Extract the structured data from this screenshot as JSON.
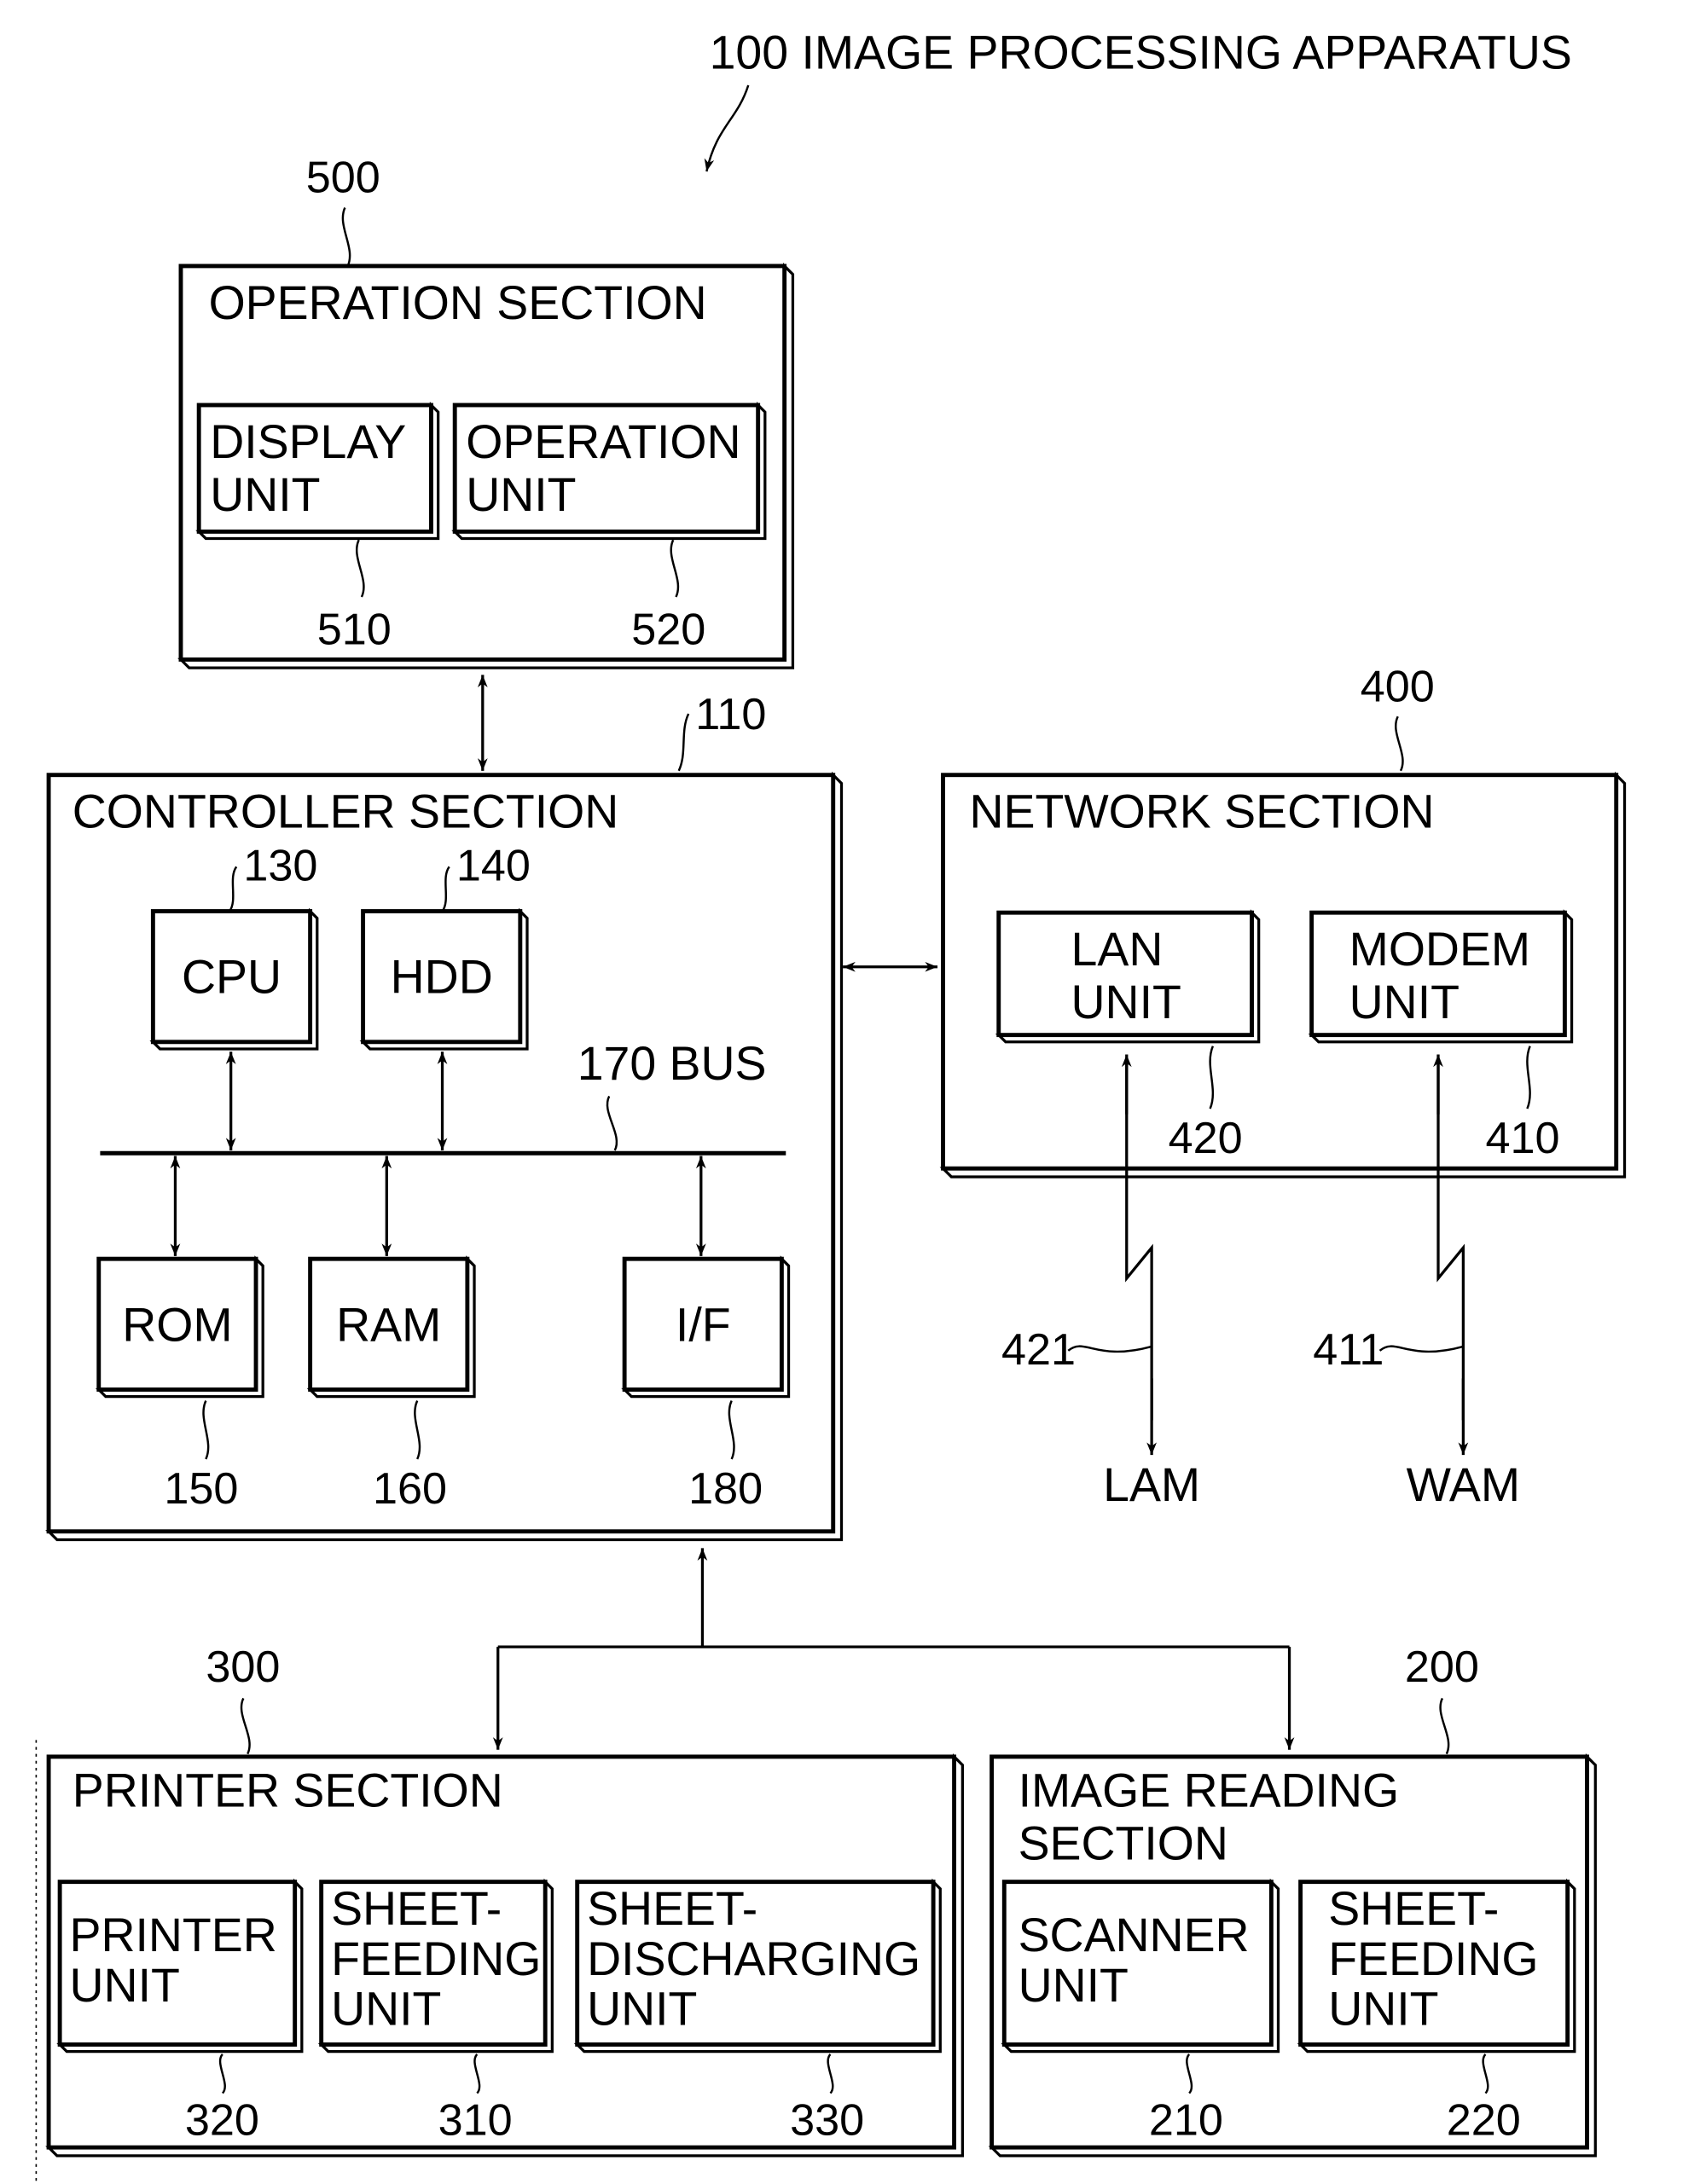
{
  "title": "100 IMAGE PROCESSING APPARATUS",
  "sections": {
    "operation": {
      "label": "OPERATION SECTION",
      "ref": "500",
      "units": [
        {
          "lines": [
            "DISPLAY",
            "UNIT"
          ],
          "ref": "510"
        },
        {
          "lines": [
            "OPERATION",
            "UNIT"
          ],
          "ref": "520"
        }
      ]
    },
    "controller": {
      "label": "CONTROLLER SECTION",
      "ref": "110",
      "bus_label": "170 BUS",
      "units": [
        {
          "lines": [
            "CPU"
          ],
          "ref": "130"
        },
        {
          "lines": [
            "HDD"
          ],
          "ref": "140"
        },
        {
          "lines": [
            "ROM"
          ],
          "ref": "150"
        },
        {
          "lines": [
            "RAM"
          ],
          "ref": "160"
        },
        {
          "lines": [
            "I/F"
          ],
          "ref": "180"
        }
      ]
    },
    "network": {
      "label": "NETWORK SECTION",
      "ref": "400",
      "units": [
        {
          "lines": [
            "LAN",
            "UNIT"
          ],
          "ref": "420"
        },
        {
          "lines": [
            "MODEM",
            "UNIT"
          ],
          "ref": "410"
        }
      ],
      "links": [
        {
          "ref": "421",
          "end_label": "LAM"
        },
        {
          "ref": "411",
          "end_label": "WAM"
        }
      ]
    },
    "printer": {
      "label": "PRINTER SECTION",
      "ref": "300",
      "units": [
        {
          "lines": [
            "PRINTER",
            "UNIT"
          ],
          "ref": "320"
        },
        {
          "lines": [
            "SHEET-",
            "FEEDING",
            "UNIT"
          ],
          "ref": "310"
        },
        {
          "lines": [
            "SHEET-",
            "DISCHARGING",
            "UNIT"
          ],
          "ref": "330"
        }
      ]
    },
    "reading": {
      "label_lines": [
        "IMAGE READING",
        "SECTION"
      ],
      "ref": "200",
      "units": [
        {
          "lines": [
            "SCANNER",
            "UNIT"
          ],
          "ref": "210"
        },
        {
          "lines": [
            "SHEET-",
            "FEEDING",
            "UNIT"
          ],
          "ref": "220"
        }
      ]
    }
  }
}
